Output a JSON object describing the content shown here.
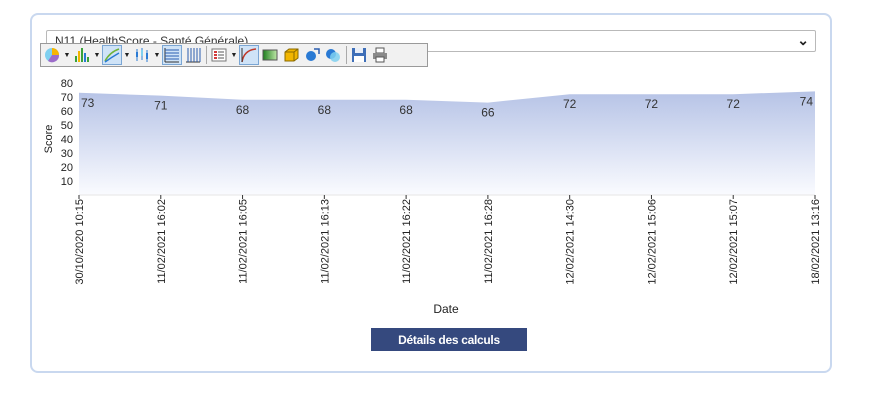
{
  "selector": {
    "value": "N11 (HealthScore - Santé Générale)"
  },
  "toolbar": {
    "buttons": [
      "pie-chart-icon",
      "bar-chart-icon",
      "line-chart-icon",
      "candlestick-icon",
      "horizontal-grid-icon",
      "vertical-grid-icon",
      "legend-icon",
      "trend-line-icon",
      "gradient-fill-icon",
      "3d-box-icon",
      "rotate-icon",
      "transparency-icon",
      "save-icon",
      "print-icon"
    ]
  },
  "chart_data": {
    "type": "area",
    "xlabel": "Date",
    "ylabel": "Score",
    "ylim": [
      0,
      80
    ],
    "yticks": [
      10,
      20,
      30,
      40,
      50,
      60,
      70,
      80
    ],
    "categories": [
      "30/10/2020 10:15",
      "11/02/2021 16:02",
      "11/02/2021 16:05",
      "11/02/2021 16:13",
      "11/02/2021 16:22",
      "11/02/2021 16:28",
      "12/02/2021 14:30",
      "12/02/2021 15:06",
      "12/02/2021 15:07",
      "18/02/2021 13:16"
    ],
    "values": [
      73,
      71,
      68,
      68,
      68,
      66,
      72,
      72,
      72,
      74
    ],
    "fill_top": "#b6c3e6",
    "fill_bottom": "#fafbff",
    "grid": false
  },
  "details_button": {
    "label": "Détails des calculs",
    "color": "#35497e"
  }
}
